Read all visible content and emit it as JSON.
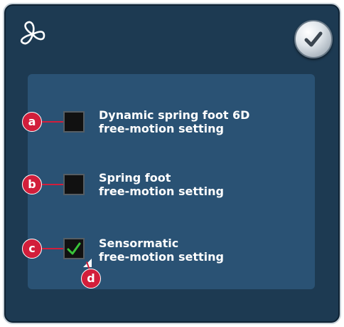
{
  "header": {
    "icon": "fan-icon",
    "confirm_icon": "checkmark-icon"
  },
  "options": [
    {
      "callout": "a",
      "label": "Dynamic spring foot 6D\nfree-motion setting",
      "checked": false
    },
    {
      "callout": "b",
      "label": "Spring foot\nfree-motion setting",
      "checked": false
    },
    {
      "callout": "c",
      "label": "Sensormatic\nfree-motion setting",
      "checked": true,
      "extra_callout": "d"
    }
  ],
  "colors": {
    "panel": "#1d3a52",
    "inner": "#2a5274",
    "callout": "#d21e3b",
    "check": "#39c43a"
  }
}
